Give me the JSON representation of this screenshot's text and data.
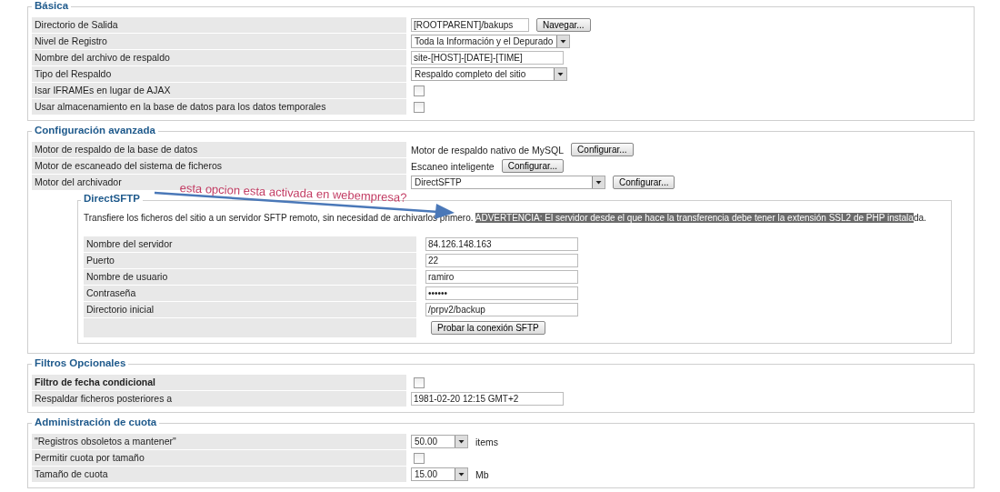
{
  "annotation": {
    "text": "esta opcion esta activada en webempresa?"
  },
  "sections": [
    {
      "title": "Básica",
      "rows": [
        {
          "label": "Directorio de Salida",
          "kind": "input-button",
          "value": "[ROOTPARENT]/bakups",
          "button": "Navegar..."
        },
        {
          "label": "Nivel de Registro",
          "kind": "select",
          "value": "Toda la Información y el Depurado"
        },
        {
          "label": "Nombre del archivo de respaldo",
          "kind": "input",
          "value": "site-[HOST]-[DATE]-[TIME]"
        },
        {
          "label": "Tipo del Respaldo",
          "kind": "select",
          "value": "Respaldo completo del sitio"
        },
        {
          "label": "Isar IFRAMEs en lugar de AJAX",
          "kind": "checkbox",
          "checked": false
        },
        {
          "label": "Usar almacenamiento en la base de datos para los datos temporales",
          "kind": "checkbox",
          "checked": false
        }
      ]
    },
    {
      "title": "Configuración avanzada",
      "rows": [
        {
          "label": "Motor de respaldo de la base de datos",
          "kind": "text-button",
          "value": "Motor de respaldo nativo de MySQL",
          "button": "Configurar..."
        },
        {
          "label": "Motor de escaneado del sistema de ficheros",
          "kind": "text-button",
          "value": "Escaneo inteligente",
          "button": "Configurar..."
        },
        {
          "label": "Motor del archivador",
          "kind": "select-button",
          "value": "DirectSFTP",
          "button": "Configurar..."
        }
      ],
      "subsection": {
        "title": "DirectSFTP",
        "description": "Transfiere los ficheros del sitio a un servidor SFTP remoto, sin necesidad de archivarlos primero.",
        "highlighted": "ADVERTENCIA: El servidor desde el que hace la transferencia debe tener la extensión SSL2 de PHP instala",
        "tail": "da.",
        "rows": [
          {
            "label": "Nombre del servidor",
            "kind": "input",
            "value": "84.126.148.163"
          },
          {
            "label": "Puerto",
            "kind": "input",
            "value": "22"
          },
          {
            "label": "Nombre de usuario",
            "kind": "input",
            "value": "ramiro"
          },
          {
            "label": "Contraseña",
            "kind": "input",
            "value": "••••••"
          },
          {
            "label": "Directorio inicial",
            "kind": "input",
            "value": "/prpv2/backup"
          },
          {
            "kind": "button",
            "button": "Probar la conexión SFTP"
          }
        ]
      }
    },
    {
      "title": "Filtros Opcionales",
      "rows": [
        {
          "label": "Filtro de fecha condicional",
          "kind": "checkbox",
          "checked": false,
          "bold": true
        },
        {
          "label": "Respaldar ficheros posteriores a",
          "kind": "input",
          "value": "1981-02-20 12:15 GMT+2"
        }
      ]
    },
    {
      "title": "Administración de cuota",
      "rows": [
        {
          "label": "\"Registros obsoletos a mantener\"",
          "kind": "select-unit",
          "value": "50.00",
          "unit": "items"
        },
        {
          "label": "Permitir cuota por tamaño",
          "kind": "checkbox",
          "checked": false
        },
        {
          "label": "Tamaño de cuota",
          "kind": "select-unit",
          "value": "15.00",
          "unit": "Mb"
        }
      ]
    }
  ]
}
